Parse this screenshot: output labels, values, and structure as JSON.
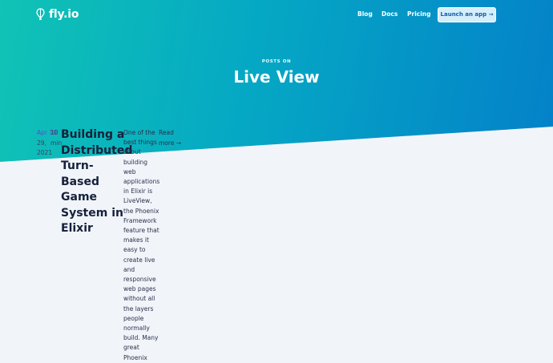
{
  "brand": {
    "name": "fly.io"
  },
  "nav": {
    "links": [
      "Blog",
      "Docs",
      "Pricing"
    ],
    "cta": "Launch an app →"
  },
  "hero": {
    "eyebrow": "POSTS ON",
    "title": "Live View"
  },
  "post": {
    "date_month_day": "Apr 10",
    "date_line2": "29,",
    "date_line3": "2021",
    "read_time_line1": "10",
    "read_time_line2": "min",
    "title": "Building a Distributed Turn-Based Game System in Elixir",
    "excerpt": "One of the best things about building web applications in Elixir is LiveView, the Phoenix Framework feature that makes it easy to create live and responsive web pages without all the layers people normally build. Many great Phoenix",
    "read_more": "Read more →"
  },
  "colors": {
    "hero_gradient_start": "#10c3b5",
    "hero_gradient_end": "#0481c9",
    "page_background": "#f1f5fa",
    "cta_background": "#d6eefc",
    "cta_text": "#0b5ea8",
    "date_accent": "#5a4bd6"
  }
}
